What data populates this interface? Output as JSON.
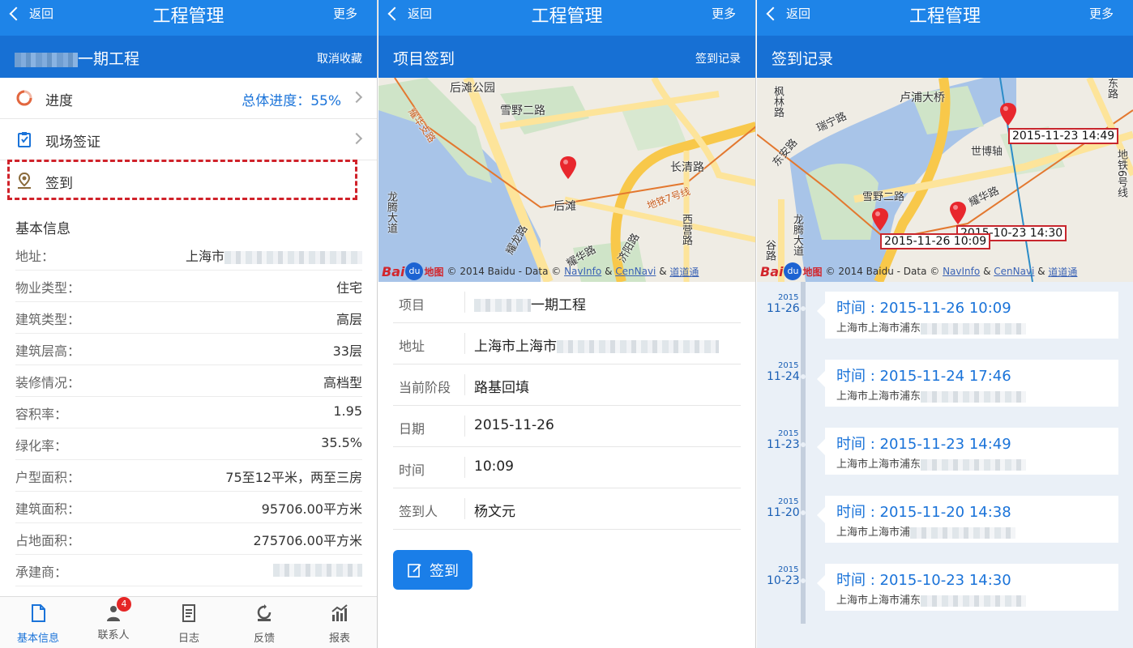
{
  "colors": {
    "header": "#1e84e8",
    "subheader": "#1770d4",
    "accent": "#1a73d9",
    "highlight": "#d0222a"
  },
  "panel1": {
    "header": {
      "back": "返回",
      "title": "工程管理",
      "more": "更多"
    },
    "project": {
      "name": "一期工程",
      "action": "取消收藏"
    },
    "menu": [
      {
        "icon": "progress-ring-icon",
        "label": "进度",
        "value": "总体进度：55%"
      },
      {
        "icon": "clipboard-icon",
        "label": "现场签证",
        "value": ""
      },
      {
        "icon": "location-person-icon",
        "label": "签到",
        "value": ""
      }
    ],
    "section_title": "基本信息",
    "info": [
      {
        "key": "地址：",
        "value": "上海市"
      },
      {
        "key": "物业类型：",
        "value": "住宅"
      },
      {
        "key": "建筑类型：",
        "value": "高层"
      },
      {
        "key": "建筑层高：",
        "value": "33层"
      },
      {
        "key": "装修情况：",
        "value": "高档型"
      },
      {
        "key": "容积率：",
        "value": "1.95"
      },
      {
        "key": "绿化率：",
        "value": "35.5%"
      },
      {
        "key": "户型面积：",
        "value": "75至12平米，两至三房"
      },
      {
        "key": "建筑面积：",
        "value": "95706.00平方米"
      },
      {
        "key": "占地面积：",
        "value": "275706.00平方米"
      },
      {
        "key": "承建商：",
        "value": ""
      }
    ],
    "tabs": [
      {
        "icon": "document-icon",
        "label": "基本信息",
        "active": true
      },
      {
        "icon": "contacts-icon",
        "label": "联系人",
        "badge": "4"
      },
      {
        "icon": "log-icon",
        "label": "日志"
      },
      {
        "icon": "feedback-icon",
        "label": "反馈"
      },
      {
        "icon": "report-chart-icon",
        "label": "报表"
      }
    ]
  },
  "panel2": {
    "header": {
      "back": "返回",
      "title": "工程管理",
      "more": "更多"
    },
    "subtitle": "项目签到",
    "sub_action": "签到记录",
    "map": {
      "labels": [
        "后滩公园",
        "雪野二路",
        "长清路",
        "后滩",
        "地铁7号线",
        "西营路",
        "耀龙路",
        "耀华路",
        "济阳路",
        "龙腾大道",
        "耀华支路"
      ],
      "copyright": {
        "baidu": "Bai",
        "du": "du",
        "ditu": "地图",
        "text": "© 2014 Baidu - Data ©",
        "navinfo": "NavInfo",
        "amp": "&",
        "cennavi": "CenNavi",
        "amp2": "&",
        "daodao": "道道通"
      }
    },
    "form": [
      {
        "key": "项目",
        "value": "一期工程"
      },
      {
        "key": "地址",
        "value": "上海市上海市"
      },
      {
        "key": "当前阶段",
        "value": "路基回填"
      },
      {
        "key": "日期",
        "value": "2015-11-26"
      },
      {
        "key": "时间",
        "value": "10:09"
      },
      {
        "key": "签到人",
        "value": "杨文元"
      }
    ],
    "sign_button": "签到"
  },
  "panel3": {
    "header": {
      "back": "返回",
      "title": "工程管理",
      "more": "更多"
    },
    "subtitle": "签到记录",
    "map": {
      "labels": [
        "卢浦大桥",
        "枫林路",
        "瑞宁路",
        "东安路",
        "世博轴",
        "雪野二路",
        "耀华路",
        "龙腾大道",
        "谷路",
        "地铁6号线",
        "东路"
      ],
      "callouts": [
        "2015-11-23 14:49",
        "2015-10-23 14:30",
        "2015-11-26 10:09"
      ],
      "copyright": {
        "baidu": "Bai",
        "du": "du",
        "ditu": "地图",
        "text": "© 2014 Baidu - Data ©",
        "navinfo": "NavInfo",
        "amp": "&",
        "cennavi": "CenNavi",
        "amp2": "&",
        "daodao": "道道通"
      }
    },
    "records": [
      {
        "year": "2015",
        "md": "11-26",
        "time": "时间 : 2015-11-26 10:09",
        "addr": "上海市上海市浦东"
      },
      {
        "year": "2015",
        "md": "11-24",
        "time": "时间 : 2015-11-24 17:46",
        "addr": "上海市上海市浦东"
      },
      {
        "year": "2015",
        "md": "11-23",
        "time": "时间 : 2015-11-23 14:49",
        "addr": "上海市上海市浦东"
      },
      {
        "year": "2015",
        "md": "11-20",
        "time": "时间 : 2015-11-20 14:38",
        "addr": "上海市上海市浦"
      },
      {
        "year": "2015",
        "md": "10-23",
        "time": "时间 : 2015-10-23 14:30",
        "addr": "上海市上海市浦东"
      }
    ]
  }
}
